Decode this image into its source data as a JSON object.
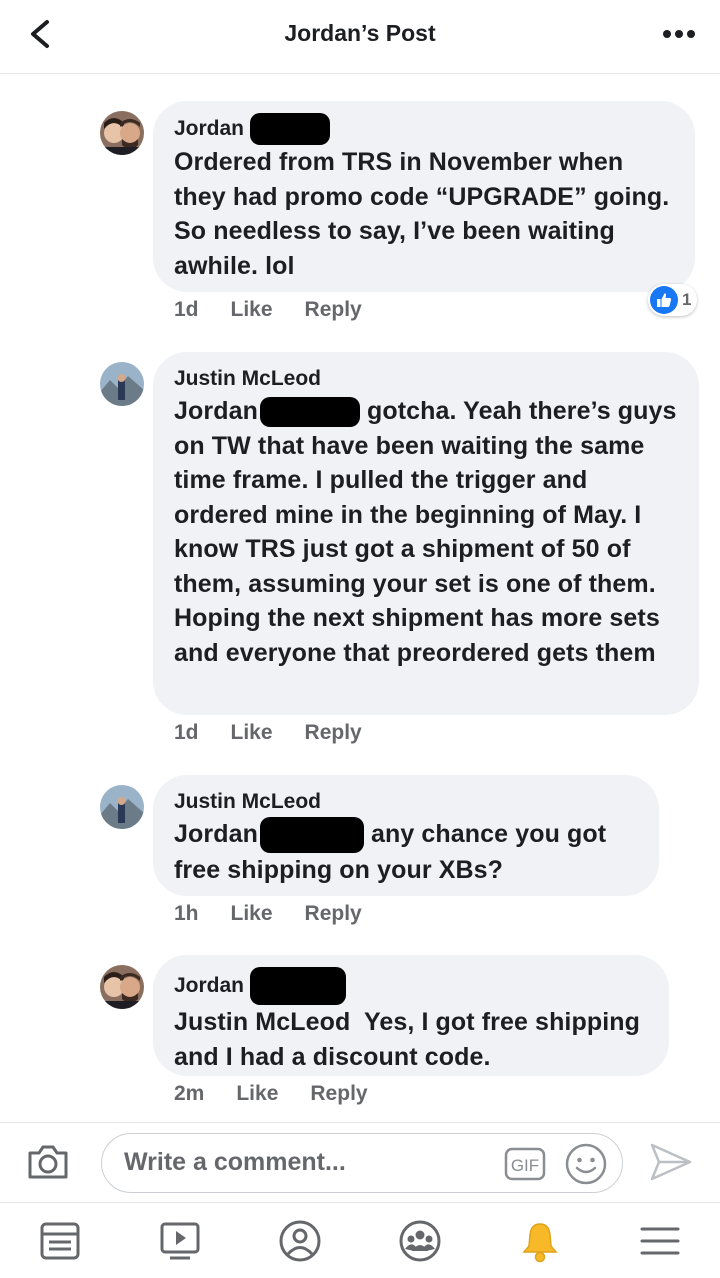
{
  "header": {
    "title": "Jordan’s Post"
  },
  "comments": [
    {
      "author": "Jordan",
      "text": "Ordered from TRS in November when they had promo code “UPGRADE” going. So needless to say, I’ve been waiting awhile. lol",
      "time": "1d",
      "like_label": "Like",
      "reply_label": "Reply",
      "reaction_count": "1"
    },
    {
      "author": "Justin McLeod",
      "mention": "Jordan",
      "text": " gotcha. Yeah there’s guys on TW that have been waiting the same time frame. I pulled the trigger and ordered mine in the beginning of May. I know TRS just got a shipment of 50 of them, assuming your set is one of them. Hoping the next shipment has more sets and everyone that preordered gets them",
      "time": "1d",
      "like_label": "Like",
      "reply_label": "Reply"
    },
    {
      "author": "Justin McLeod",
      "mention": "Jordan",
      "text": " any chance you got free shipping on your XBs?",
      "time": "1h",
      "like_label": "Like",
      "reply_label": "Reply"
    },
    {
      "author": "Jordan",
      "mention": "Justin McLeod",
      "text": "  Yes, I got free shipping and I had a discount code.",
      "time": "2m",
      "like_label": "Like",
      "reply_label": "Reply"
    }
  ],
  "composer": {
    "placeholder": "Write a comment...",
    "gif_label": "GIF"
  },
  "colors": {
    "bubble": "#f0f2f5",
    "text": "#1c1e21",
    "secondary": "#65676b",
    "like_blue": "#1877f2",
    "bell_yellow": "#f7b928"
  },
  "tabbar": {
    "icons": [
      "news-feed-icon",
      "watch-icon",
      "profile-icon",
      "groups-icon",
      "notifications-bell-icon",
      "menu-icon"
    ]
  }
}
